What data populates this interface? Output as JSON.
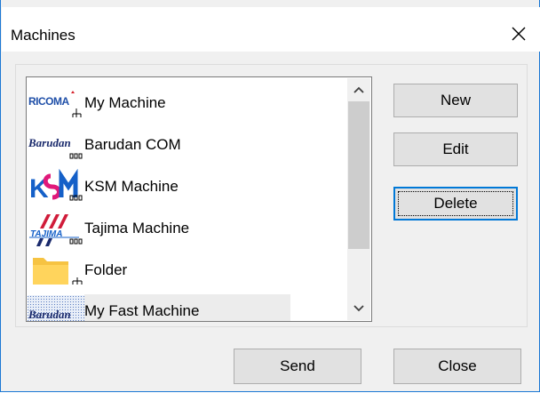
{
  "window": {
    "title": "Machines"
  },
  "machines": [
    {
      "label": "My Machine",
      "icon": "ricoma-logo-network-icon"
    },
    {
      "label": "Barudan COM",
      "icon": "barudan-logo-serial-icon"
    },
    {
      "label": "KSM Machine",
      "icon": "ksm-logo-serial-icon"
    },
    {
      "label": "Tajima Machine",
      "icon": "tajima-logo-serial-icon"
    },
    {
      "label": "Folder",
      "icon": "folder-network-icon"
    },
    {
      "label": "My Fast Machine",
      "icon": "barudan-logo-selected-icon"
    }
  ],
  "buttons": {
    "new_label": "New",
    "edit_label": "Edit",
    "delete_label": "Delete",
    "send_label": "Send",
    "close_label": "Close"
  },
  "logo_text": {
    "ricoma": "RICOMA",
    "barudan": "Barudan",
    "tajima": "TAJIMA"
  },
  "colors": {
    "accent": "#0078d7",
    "window_border": "#1c78d4",
    "ricoma_blue": "#1f4fa8",
    "ricoma_red": "#d6202a",
    "barudan_navy": "#1a2a6c",
    "ksm_magenta": "#e0197a",
    "ksm_blue": "#1560c8",
    "tajima_red": "#d01c3a",
    "folder_yellow": "#f6c342"
  }
}
